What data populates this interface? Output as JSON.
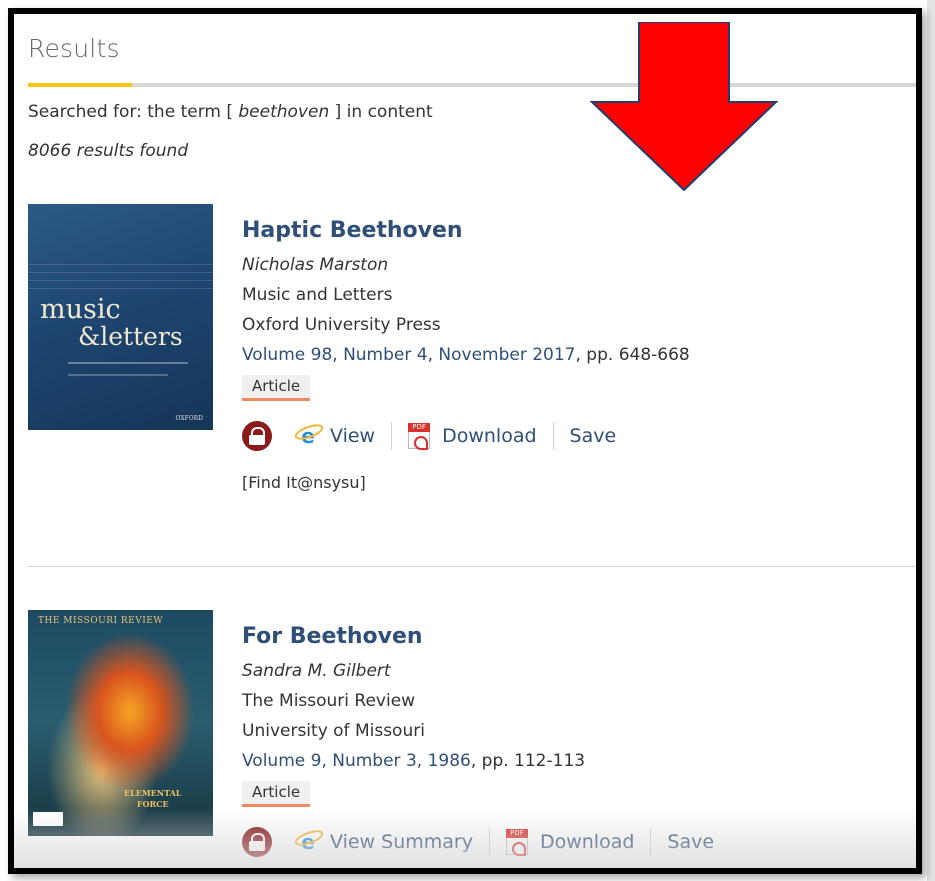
{
  "heading": "Results",
  "search": {
    "prefix": "Searched for: the term [",
    "term": "beethoven",
    "suffix": "] in content",
    "count": "8066 results found"
  },
  "results": [
    {
      "title": "Haptic Beethoven",
      "author": "Nicholas Marston",
      "journal": "Music and Letters",
      "publisher": "Oxford University Press",
      "volume_link": "Volume 98, Number 4, November 2017",
      "pages": ", pp. 648-668",
      "type": "Article",
      "actions": {
        "view": "View",
        "download": "Download",
        "save": "Save"
      },
      "findit": "[Find It@nsysu]",
      "cover": {
        "line1": "music",
        "line2": "&letters",
        "publisher_mark": "OXFORD"
      }
    },
    {
      "title": "For Beethoven",
      "author": "Sandra M. Gilbert",
      "journal": "The Missouri Review",
      "publisher": "University of Missouri",
      "volume_link": "Volume 9, Number 3, 1986",
      "pages": ", pp. 112-113",
      "type": "Article",
      "actions": {
        "view": "View Summary",
        "download": "Download",
        "save": "Save"
      },
      "cover": {
        "masthead": "THE MISSOURI REVIEW",
        "line1": "ELEMENTAL",
        "line2": "FORCE"
      }
    }
  ],
  "colors": {
    "title": "#2f4f77",
    "accent_rule": "#f5c518",
    "badge_underline": "#f08a5d",
    "lock": "#8b1a1a",
    "arrow": "#ff0000"
  },
  "icons": {
    "lock": "lock-icon",
    "view": "ie-icon",
    "download": "pdf-icon"
  }
}
